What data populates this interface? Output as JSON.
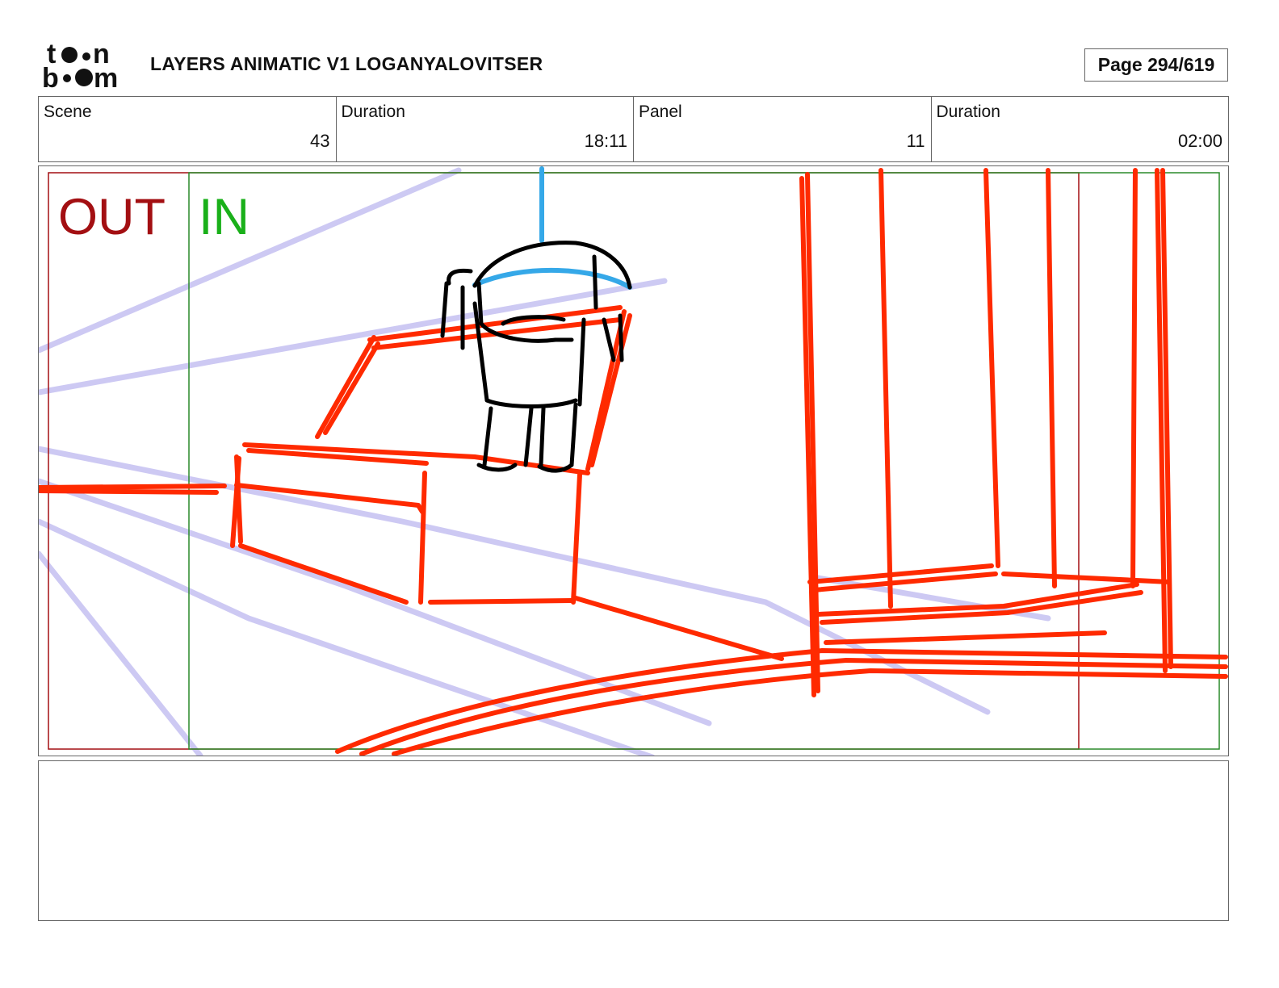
{
  "header": {
    "logo_text_top": "toon",
    "logo_text_bottom": "boom",
    "title": "LAYERS ANIMATIC V1 LOGANYALOVITSER",
    "page": "Page 294/619"
  },
  "info": {
    "scene_label": "Scene",
    "scene_value": "43",
    "scene_duration_label": "Duration",
    "scene_duration_value": "18:11",
    "panel_label": "Panel",
    "panel_value": "11",
    "panel_duration_label": "Duration",
    "panel_duration_value": "02:00"
  },
  "panel": {
    "out_label": "OUT",
    "in_label": "IN",
    "colors": {
      "out": "#a30f12",
      "in": "#1ab01a",
      "sketch_red": "#ff2a00",
      "guide_lavender": "#c8c4f2",
      "character": "#000000",
      "rope_blue": "#35a8e8"
    }
  },
  "notes": {
    "text": ""
  }
}
